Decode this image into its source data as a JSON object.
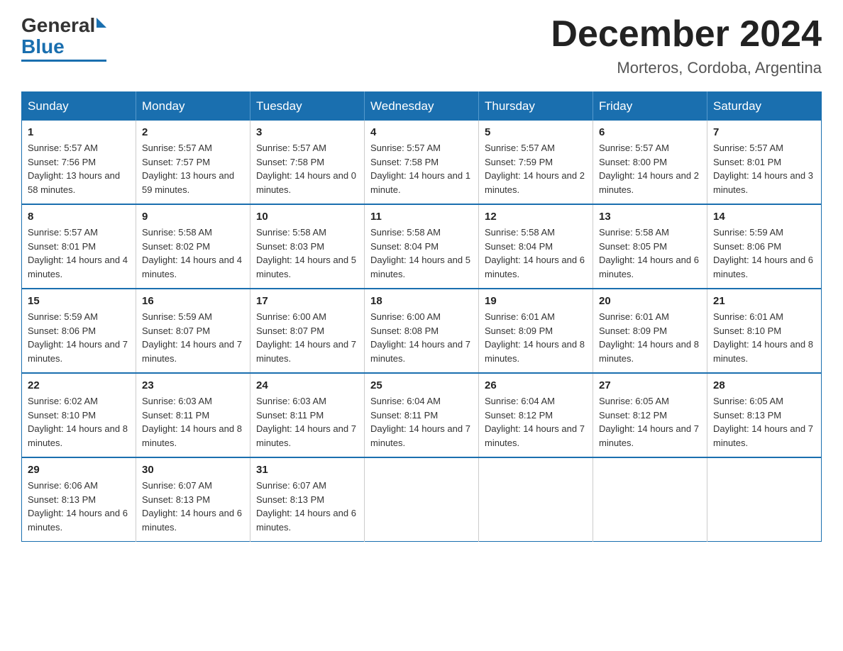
{
  "logo": {
    "general": "General",
    "blue": "Blue"
  },
  "title": "December 2024",
  "subtitle": "Morteros, Cordoba, Argentina",
  "weekdays": [
    "Sunday",
    "Monday",
    "Tuesday",
    "Wednesday",
    "Thursday",
    "Friday",
    "Saturday"
  ],
  "weeks": [
    [
      {
        "day": "1",
        "sunrise": "5:57 AM",
        "sunset": "7:56 PM",
        "daylight": "13 hours and 58 minutes."
      },
      {
        "day": "2",
        "sunrise": "5:57 AM",
        "sunset": "7:57 PM",
        "daylight": "13 hours and 59 minutes."
      },
      {
        "day": "3",
        "sunrise": "5:57 AM",
        "sunset": "7:58 PM",
        "daylight": "14 hours and 0 minutes."
      },
      {
        "day": "4",
        "sunrise": "5:57 AM",
        "sunset": "7:58 PM",
        "daylight": "14 hours and 1 minute."
      },
      {
        "day": "5",
        "sunrise": "5:57 AM",
        "sunset": "7:59 PM",
        "daylight": "14 hours and 2 minutes."
      },
      {
        "day": "6",
        "sunrise": "5:57 AM",
        "sunset": "8:00 PM",
        "daylight": "14 hours and 2 minutes."
      },
      {
        "day": "7",
        "sunrise": "5:57 AM",
        "sunset": "8:01 PM",
        "daylight": "14 hours and 3 minutes."
      }
    ],
    [
      {
        "day": "8",
        "sunrise": "5:57 AM",
        "sunset": "8:01 PM",
        "daylight": "14 hours and 4 minutes."
      },
      {
        "day": "9",
        "sunrise": "5:58 AM",
        "sunset": "8:02 PM",
        "daylight": "14 hours and 4 minutes."
      },
      {
        "day": "10",
        "sunrise": "5:58 AM",
        "sunset": "8:03 PM",
        "daylight": "14 hours and 5 minutes."
      },
      {
        "day": "11",
        "sunrise": "5:58 AM",
        "sunset": "8:04 PM",
        "daylight": "14 hours and 5 minutes."
      },
      {
        "day": "12",
        "sunrise": "5:58 AM",
        "sunset": "8:04 PM",
        "daylight": "14 hours and 6 minutes."
      },
      {
        "day": "13",
        "sunrise": "5:58 AM",
        "sunset": "8:05 PM",
        "daylight": "14 hours and 6 minutes."
      },
      {
        "day": "14",
        "sunrise": "5:59 AM",
        "sunset": "8:06 PM",
        "daylight": "14 hours and 6 minutes."
      }
    ],
    [
      {
        "day": "15",
        "sunrise": "5:59 AM",
        "sunset": "8:06 PM",
        "daylight": "14 hours and 7 minutes."
      },
      {
        "day": "16",
        "sunrise": "5:59 AM",
        "sunset": "8:07 PM",
        "daylight": "14 hours and 7 minutes."
      },
      {
        "day": "17",
        "sunrise": "6:00 AM",
        "sunset": "8:07 PM",
        "daylight": "14 hours and 7 minutes."
      },
      {
        "day": "18",
        "sunrise": "6:00 AM",
        "sunset": "8:08 PM",
        "daylight": "14 hours and 7 minutes."
      },
      {
        "day": "19",
        "sunrise": "6:01 AM",
        "sunset": "8:09 PM",
        "daylight": "14 hours and 8 minutes."
      },
      {
        "day": "20",
        "sunrise": "6:01 AM",
        "sunset": "8:09 PM",
        "daylight": "14 hours and 8 minutes."
      },
      {
        "day": "21",
        "sunrise": "6:01 AM",
        "sunset": "8:10 PM",
        "daylight": "14 hours and 8 minutes."
      }
    ],
    [
      {
        "day": "22",
        "sunrise": "6:02 AM",
        "sunset": "8:10 PM",
        "daylight": "14 hours and 8 minutes."
      },
      {
        "day": "23",
        "sunrise": "6:03 AM",
        "sunset": "8:11 PM",
        "daylight": "14 hours and 8 minutes."
      },
      {
        "day": "24",
        "sunrise": "6:03 AM",
        "sunset": "8:11 PM",
        "daylight": "14 hours and 7 minutes."
      },
      {
        "day": "25",
        "sunrise": "6:04 AM",
        "sunset": "8:11 PM",
        "daylight": "14 hours and 7 minutes."
      },
      {
        "day": "26",
        "sunrise": "6:04 AM",
        "sunset": "8:12 PM",
        "daylight": "14 hours and 7 minutes."
      },
      {
        "day": "27",
        "sunrise": "6:05 AM",
        "sunset": "8:12 PM",
        "daylight": "14 hours and 7 minutes."
      },
      {
        "day": "28",
        "sunrise": "6:05 AM",
        "sunset": "8:13 PM",
        "daylight": "14 hours and 7 minutes."
      }
    ],
    [
      {
        "day": "29",
        "sunrise": "6:06 AM",
        "sunset": "8:13 PM",
        "daylight": "14 hours and 6 minutes."
      },
      {
        "day": "30",
        "sunrise": "6:07 AM",
        "sunset": "8:13 PM",
        "daylight": "14 hours and 6 minutes."
      },
      {
        "day": "31",
        "sunrise": "6:07 AM",
        "sunset": "8:13 PM",
        "daylight": "14 hours and 6 minutes."
      },
      null,
      null,
      null,
      null
    ]
  ]
}
